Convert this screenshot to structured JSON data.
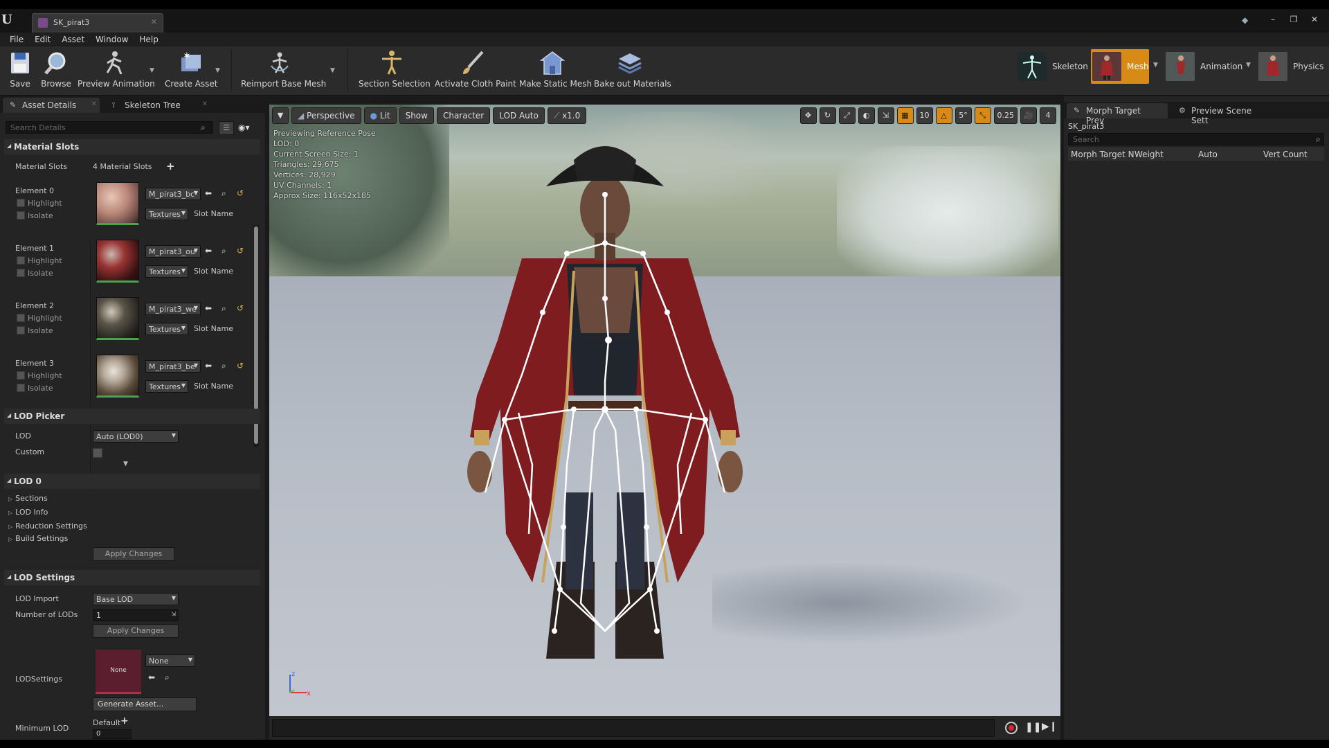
{
  "window": {
    "tab_title": "SK_pirat3",
    "controls": [
      "–",
      "❐",
      "✕"
    ]
  },
  "menu": [
    "File",
    "Edit",
    "Asset",
    "Window",
    "Help"
  ],
  "toolbar": {
    "save": "Save",
    "browse": "Browse",
    "preview_animation": "Preview Animation",
    "create_asset": "Create Asset",
    "reimport_base_mesh": "Reimport Base Mesh",
    "section_selection": "Section Selection",
    "activate_cloth_paint": "Activate Cloth Paint",
    "make_static_mesh": "Make Static Mesh",
    "bake_out_materials": "Bake out Materials"
  },
  "modes": {
    "skeleton": "Skeleton",
    "mesh": "Mesh",
    "animation": "Animation",
    "physics": "Physics",
    "active": "Mesh"
  },
  "left_panel": {
    "tabs": [
      "Asset Details",
      "Skeleton Tree"
    ],
    "search_placeholder": "Search Details",
    "material_slots": {
      "header": "Material Slots",
      "label": "Material Slots",
      "count": "4 Material Slots",
      "elements": [
        {
          "label": "Element 0",
          "material": "M_pirat3_bc",
          "highlight": "Highlight",
          "isolate": "Isolate",
          "textures": "Textures",
          "slot_name": "Slot Name"
        },
        {
          "label": "Element 1",
          "material": "M_pirat3_ou",
          "highlight": "Highlight",
          "isolate": "Isolate",
          "textures": "Textures",
          "slot_name": "Slot Name"
        },
        {
          "label": "Element 2",
          "material": "M_pirat3_we",
          "highlight": "Highlight",
          "isolate": "Isolate",
          "textures": "Textures",
          "slot_name": "Slot Name"
        },
        {
          "label": "Element 3",
          "material": "M_pirat3_be",
          "highlight": "Highlight",
          "isolate": "Isolate",
          "textures": "Textures",
          "slot_name": "Slot Name"
        }
      ]
    },
    "lod_picker": {
      "header": "LOD Picker",
      "lod_label": "LOD",
      "lod_value": "Auto (LOD0)",
      "custom_label": "Custom"
    },
    "lod0": {
      "header": "LOD 0",
      "items": [
        "Sections",
        "LOD Info",
        "Reduction Settings",
        "Build Settings"
      ],
      "apply": "Apply Changes"
    },
    "lod_settings": {
      "header": "LOD Settings",
      "lod_import_label": "LOD Import",
      "lod_import_value": "Base LOD",
      "num_lods_label": "Number of LODs",
      "num_lods_value": "1",
      "apply": "Apply Changes",
      "lod_settings_label": "LODSettings",
      "asset_thumb": "None",
      "asset_combo": "None",
      "generate": "Generate Asset...",
      "min_lod_label": "Minimum LOD",
      "min_lod_default": "Default",
      "min_lod_value": "0"
    }
  },
  "viewport": {
    "perspective": "Perspective",
    "lit": "Lit",
    "show": "Show",
    "character": "Character",
    "lod_auto": "LOD Auto",
    "speed": "x1.0",
    "grid_size": "10",
    "rot_snap": "5°",
    "scale_snap": "0.25",
    "cam_speed": "4",
    "stats": [
      "Previewing Reference Pose",
      "LOD: 0",
      "Current Screen Size: 1",
      "Triangles: 29,675",
      "Vertices: 28,929",
      "UV Channels: 1",
      "Approx Size: 116x52x185"
    ]
  },
  "right_panel": {
    "tabs": [
      "Morph Target Prev",
      "Preview Scene Sett"
    ],
    "asset_name": "SK_pirat3",
    "search_placeholder": "Search",
    "columns": [
      "Morph Target N",
      "Weight",
      "Auto",
      "Vert Count"
    ]
  },
  "colors": {
    "accent_orange": "#d88a16",
    "panel_bg": "#242424",
    "record_red": "#d8262c"
  }
}
